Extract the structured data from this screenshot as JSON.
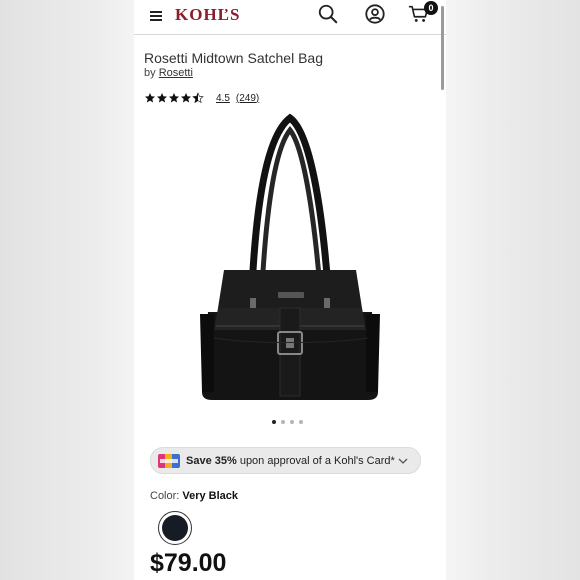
{
  "header": {
    "logo_text": "KOHĽS",
    "cart_count": "0"
  },
  "product": {
    "title": "Rosetti Midtown Satchel Bag",
    "by_label": "by",
    "brand": "Rosetti",
    "rating_value": "4.5",
    "rating_count": "(249)",
    "rating_stars": 4.5,
    "images_count": 4,
    "active_image": 1
  },
  "promo": {
    "bold": "Save 35%",
    "text": " upon approval of a Kohl's Card*"
  },
  "color": {
    "label": "Color:",
    "value": "Very Black",
    "swatch_color": "#171b26"
  },
  "price": "$79.00",
  "colors": {
    "brand": "#8b1d2c",
    "text": "#222222"
  }
}
